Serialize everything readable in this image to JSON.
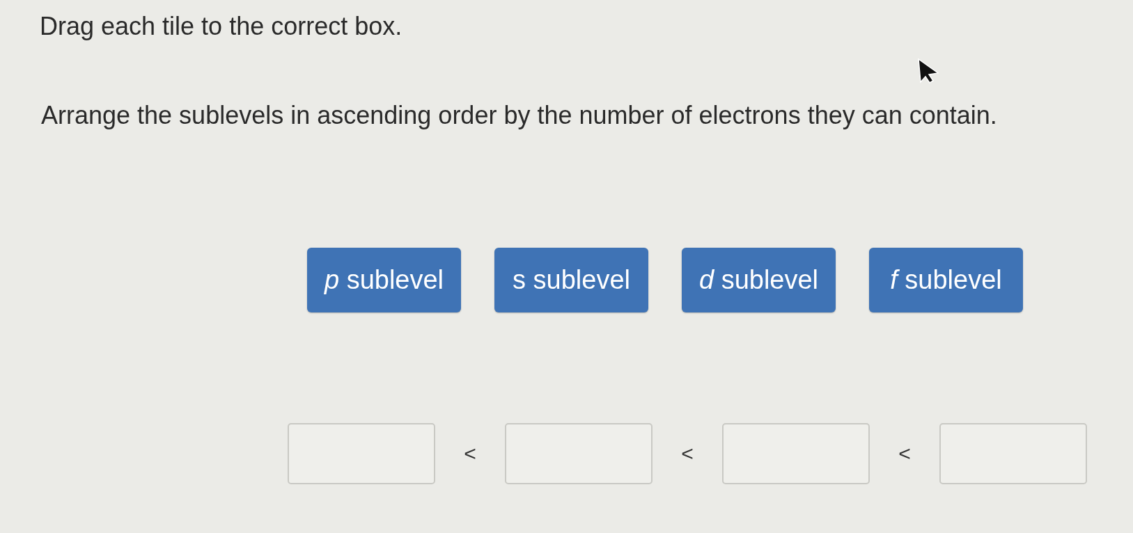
{
  "title": "Drag each tile to the correct box.",
  "prompt": "Arrange the sublevels in ascending order by the number of electrons they can contain.",
  "tiles": [
    {
      "label": "*p* sublevel"
    },
    {
      "label": "s sublevel"
    },
    {
      "label": "*d* sublevel"
    },
    {
      "label": "*f* sublevel"
    }
  ],
  "answer_row": {
    "slots": [
      {
        "filled": false
      },
      {
        "filled": false
      },
      {
        "filled": false
      },
      {
        "filled": false
      }
    ],
    "separators": [
      "<",
      "<",
      "<"
    ]
  }
}
